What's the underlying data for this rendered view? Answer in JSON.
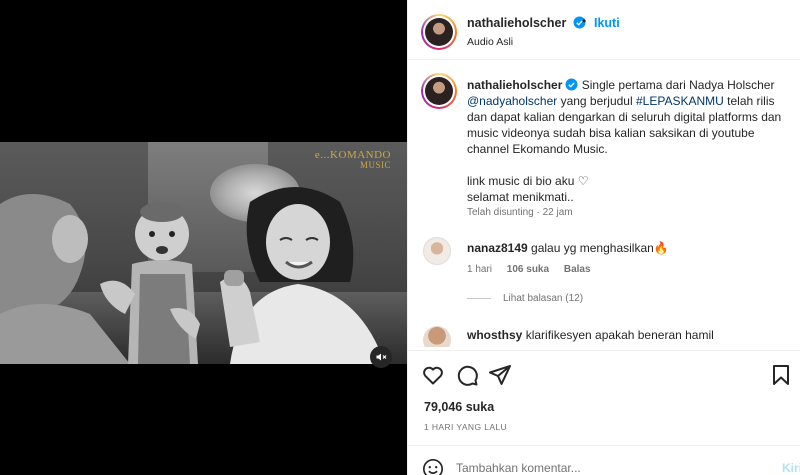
{
  "video": {
    "logo_main": "e...KOMANDO",
    "logo_sub": "MUSIC",
    "mute_icon": "speaker-muted-icon"
  },
  "header": {
    "username": "nathalieholscher",
    "separator": "•",
    "follow_label": "Ikuti",
    "audio_label": "Audio Asli"
  },
  "caption": {
    "username": "nathalieholscher",
    "text_1": "Single pertama dari Nadya Holscher",
    "mention": "@nadyaholscher",
    "text_2": "yang berjudul",
    "hashtag": "#LEPASKANMU",
    "text_3": "telah rilis dan dapat kalian dengarkan di seluruh digital platforms dan music videonya sudah bisa kalian saksikan di youtube channel Ekomando Music.",
    "line_2": "link music di bio aku ♡",
    "line_3": "selamat menikmati..",
    "edited": "Telah disunting · 22 jam"
  },
  "comments": [
    {
      "username": "nanaz8149",
      "text": "galau yg menghasilkan🔥",
      "time": "1 hari",
      "likes": "106 suka",
      "reply_label": "Balas",
      "view_replies": "Lihat balasan (12)"
    },
    {
      "username": "whosthsy",
      "text": "klarifikesyen apakah beneran hamil"
    }
  ],
  "actions": {
    "like_icon": "heart-icon",
    "comment_icon": "comment-icon",
    "share_icon": "share-icon",
    "save_icon": "bookmark-icon"
  },
  "likes": "79,046 suka",
  "date": "1 HARI YANG LALU",
  "add_comment": {
    "placeholder": "Tambahkan komentar...",
    "post_label": "Kirim",
    "emoji_icon": "smiley-icon"
  },
  "colors": {
    "accent": "#0095f6",
    "link": "#00376b",
    "muted": "#737373",
    "text": "#262626",
    "logo_gold": "#c9a84b"
  }
}
